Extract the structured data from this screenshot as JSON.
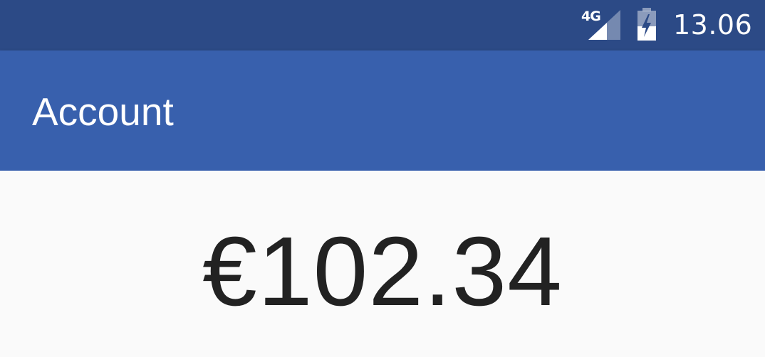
{
  "status_bar": {
    "network_type": "4G",
    "signal_icon": "cell-signal-icon",
    "battery_icon": "battery-charging-icon",
    "time": "13.06",
    "colors": {
      "background": "#2c4a86",
      "foreground": "#ffffff"
    }
  },
  "app_bar": {
    "title": "Account",
    "color": "#3860ad"
  },
  "account": {
    "balance": "€102.34"
  }
}
